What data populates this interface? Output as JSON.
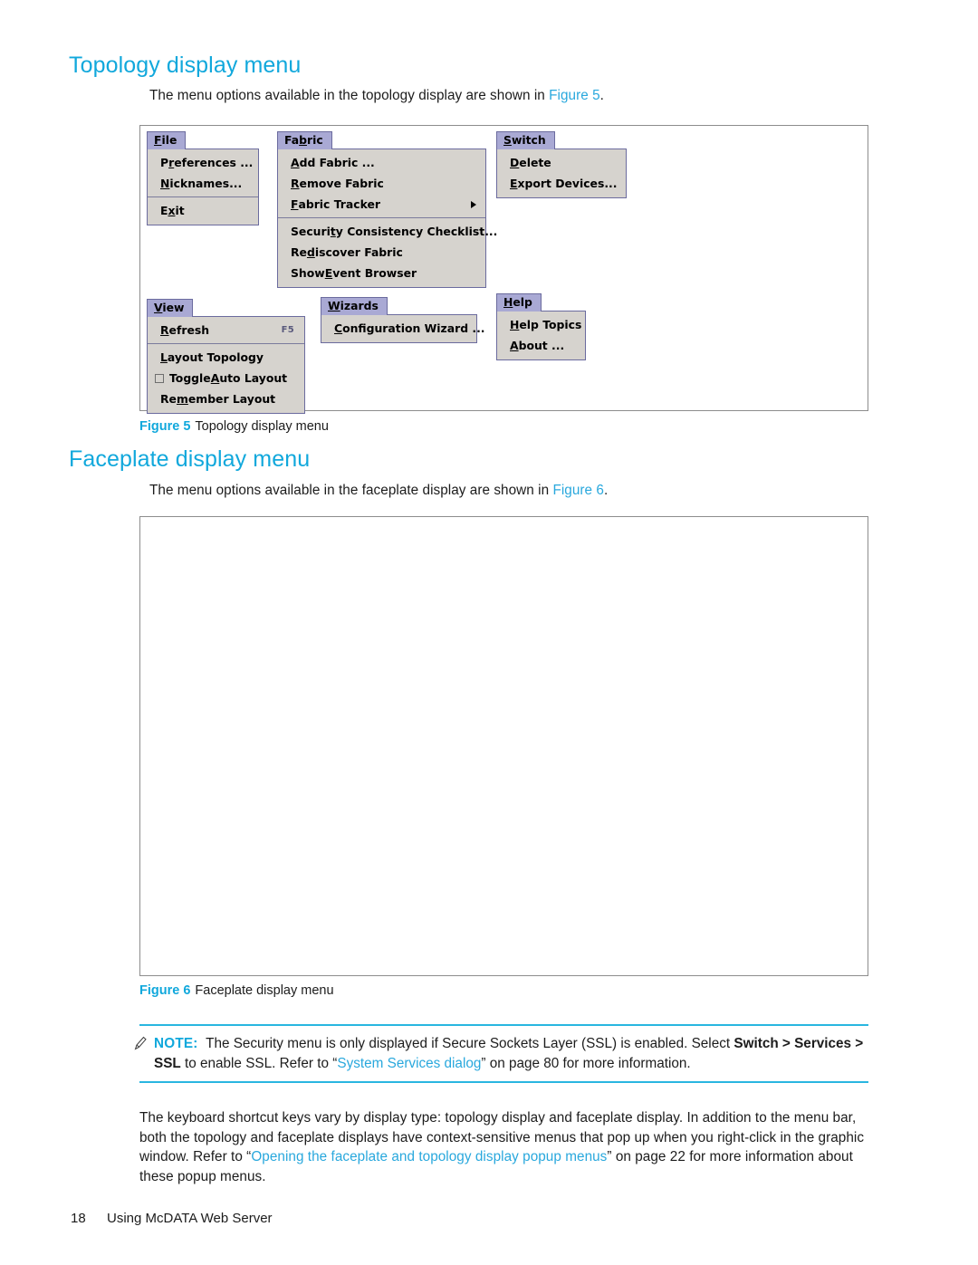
{
  "page": {
    "footer_number": "18",
    "footer_text": "Using McDATA Web Server"
  },
  "section_topology": {
    "heading": "Topology display menu",
    "intro_before": "The menu options available in the topology display are shown in ",
    "intro_link": "Figure 5",
    "intro_after": ".",
    "figure_caption_number": "Figure 5",
    "figure_caption_text": "Topology display menu"
  },
  "section_faceplate": {
    "heading": "Faceplate display menu",
    "intro_before": "The menu options available in the faceplate display are shown in ",
    "intro_link": "Figure 6",
    "intro_after": ".",
    "figure_caption_number": "Figure 6",
    "figure_caption_text": "Faceplate display menu"
  },
  "menus": {
    "file": {
      "title": "File",
      "title_mnemonic": "F",
      "items": [
        {
          "label": "Preferences ...",
          "mnemonic": "r"
        },
        {
          "label": "Nicknames...",
          "mnemonic": "N"
        },
        {
          "separator": true
        },
        {
          "label": "Exit",
          "mnemonic": "x"
        }
      ]
    },
    "fabric": {
      "title": "Fabric",
      "title_mnemonic": "b",
      "items": [
        {
          "label": "Add Fabric ...",
          "mnemonic": "A"
        },
        {
          "label": "Remove Fabric",
          "mnemonic": "R"
        },
        {
          "label": "Fabric Tracker",
          "mnemonic": "F",
          "submenu": true
        },
        {
          "separator": true
        },
        {
          "label": "Security Consistency Checklist...",
          "mnemonic": "t"
        },
        {
          "label": "Rediscover Fabric",
          "mnemonic": "d"
        },
        {
          "label": "Show Event Browser",
          "mnemonic": "E"
        }
      ]
    },
    "switch": {
      "title": "Switch",
      "title_mnemonic": "S",
      "items": [
        {
          "label": "Delete",
          "mnemonic": "D"
        },
        {
          "label": "Export Devices...",
          "mnemonic": "E"
        }
      ]
    },
    "view": {
      "title": "View",
      "title_mnemonic": "V",
      "items": [
        {
          "label": "Refresh",
          "mnemonic": "R",
          "accel": "F5"
        },
        {
          "separator": true
        },
        {
          "label": "Layout Topology",
          "mnemonic": "L"
        },
        {
          "label": "Toggle Auto Layout",
          "mnemonic": "A",
          "checkbox": true,
          "checked": false
        },
        {
          "label": "Remember Layout",
          "mnemonic": "m"
        }
      ]
    },
    "wizards": {
      "title": "Wizards",
      "title_mnemonic": "W",
      "items": [
        {
          "label": "Configuration Wizard ...",
          "mnemonic": "C"
        }
      ]
    },
    "help": {
      "title": "Help",
      "title_mnemonic": "H",
      "items": [
        {
          "label": "Help Topics",
          "mnemonic": "H"
        },
        {
          "label": "About ...",
          "mnemonic": "A"
        }
      ]
    }
  },
  "note": {
    "label": "NOTE:",
    "seg1": "The Security menu is only displayed if Secure Sockets Layer (SSL) is enabled. Select ",
    "bold1": "Switch >",
    "bold2": "Services > SSL",
    "seg2": " to enable SSL. Refer to “",
    "link": "System Services dialog",
    "seg3": "” on page 80 for more information."
  },
  "closing_paragraph": {
    "seg1": "The keyboard shortcut keys vary by display type: topology display and faceplate display. In addition to the menu bar, both the topology and faceplate displays have context-sensitive menus that pop up when you right-click in the graphic window. Refer to “",
    "link": "Opening the faceplate and topology display popup menus",
    "seg2": "” on page 22 for more information about these popup menus."
  },
  "colors": {
    "heading_blue": "#11a8dc",
    "link_blue": "#29a8dd",
    "menu_title_bg": "#a9a9d4",
    "menu_panel_bg": "#d6d3ce",
    "menu_border": "#6b6b9e",
    "figure_border": "#8d8d8d",
    "rule_cyan": "#29b6e0"
  }
}
